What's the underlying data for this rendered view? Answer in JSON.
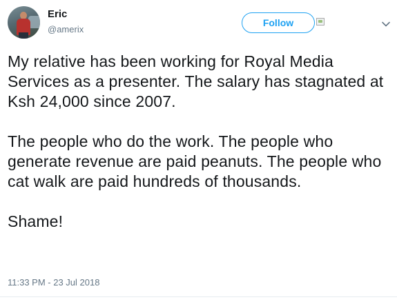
{
  "user": {
    "display_name": "Eric",
    "handle": "@amerix"
  },
  "actions": {
    "follow_label": "Follow"
  },
  "tweet": {
    "paragraphs": [
      "My relative has been working for Royal Media Services as a presenter. The salary has stagnated at Ksh 24,000 since 2007.",
      "The people who do the work. The people who generate revenue are paid peanuts. The people who cat walk are paid hundreds of thousands.",
      "Shame!"
    ],
    "timestamp": "11:33 PM - 23 Jul 2018"
  },
  "icons": {
    "avatar": "profile-photo",
    "broken_image": "broken-image-icon",
    "menu": "chevron-down-icon"
  },
  "colors": {
    "accent": "#1da1f2",
    "text_primary": "#14171a",
    "text_secondary": "#657786"
  }
}
